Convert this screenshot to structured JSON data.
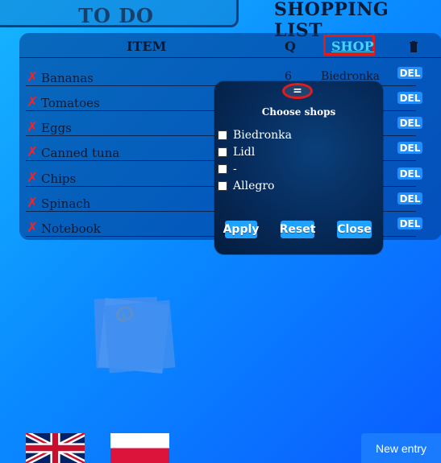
{
  "tabs": {
    "todo": "TO DO",
    "shopping": "SHOPPING LIST"
  },
  "table": {
    "headers": {
      "item": "ITEM",
      "qty": "Q",
      "shop": "SHOP"
    },
    "rows": [
      {
        "item": "Bananas",
        "qty": "6",
        "shop": "Biedronka",
        "del": "DEL",
        "remove_icon": "✗"
      },
      {
        "item": "Tomatoes",
        "qty": "",
        "shop": "",
        "del": "DEL",
        "remove_icon": "✗"
      },
      {
        "item": "Eggs",
        "qty": "",
        "shop": "",
        "del": "DEL",
        "remove_icon": "✗"
      },
      {
        "item": "Canned tuna",
        "qty": "",
        "shop": "",
        "del": "DEL",
        "remove_icon": "✗"
      },
      {
        "item": "Chips",
        "qty": "",
        "shop": "",
        "del": "DEL",
        "remove_icon": "✗"
      },
      {
        "item": "Spinach",
        "qty": "",
        "shop": "",
        "del": "DEL",
        "remove_icon": "✗"
      },
      {
        "item": "Notebook",
        "qty": "",
        "shop": "",
        "del": "DEL",
        "remove_icon": "✗"
      }
    ],
    "trash_icon": "trash-icon"
  },
  "modal": {
    "handle": "=",
    "title": "Choose shops",
    "options": [
      "Biedronka",
      "Lidl",
      "-",
      "Allegro"
    ],
    "buttons": {
      "apply": "Apply",
      "reset": "Reset",
      "close": "Close"
    }
  },
  "footer": {
    "new_entry": "New entry"
  },
  "colors": {
    "accent": "#1ea1ff",
    "highlight": "#e21b1b",
    "remove": "#ff1f1f"
  }
}
